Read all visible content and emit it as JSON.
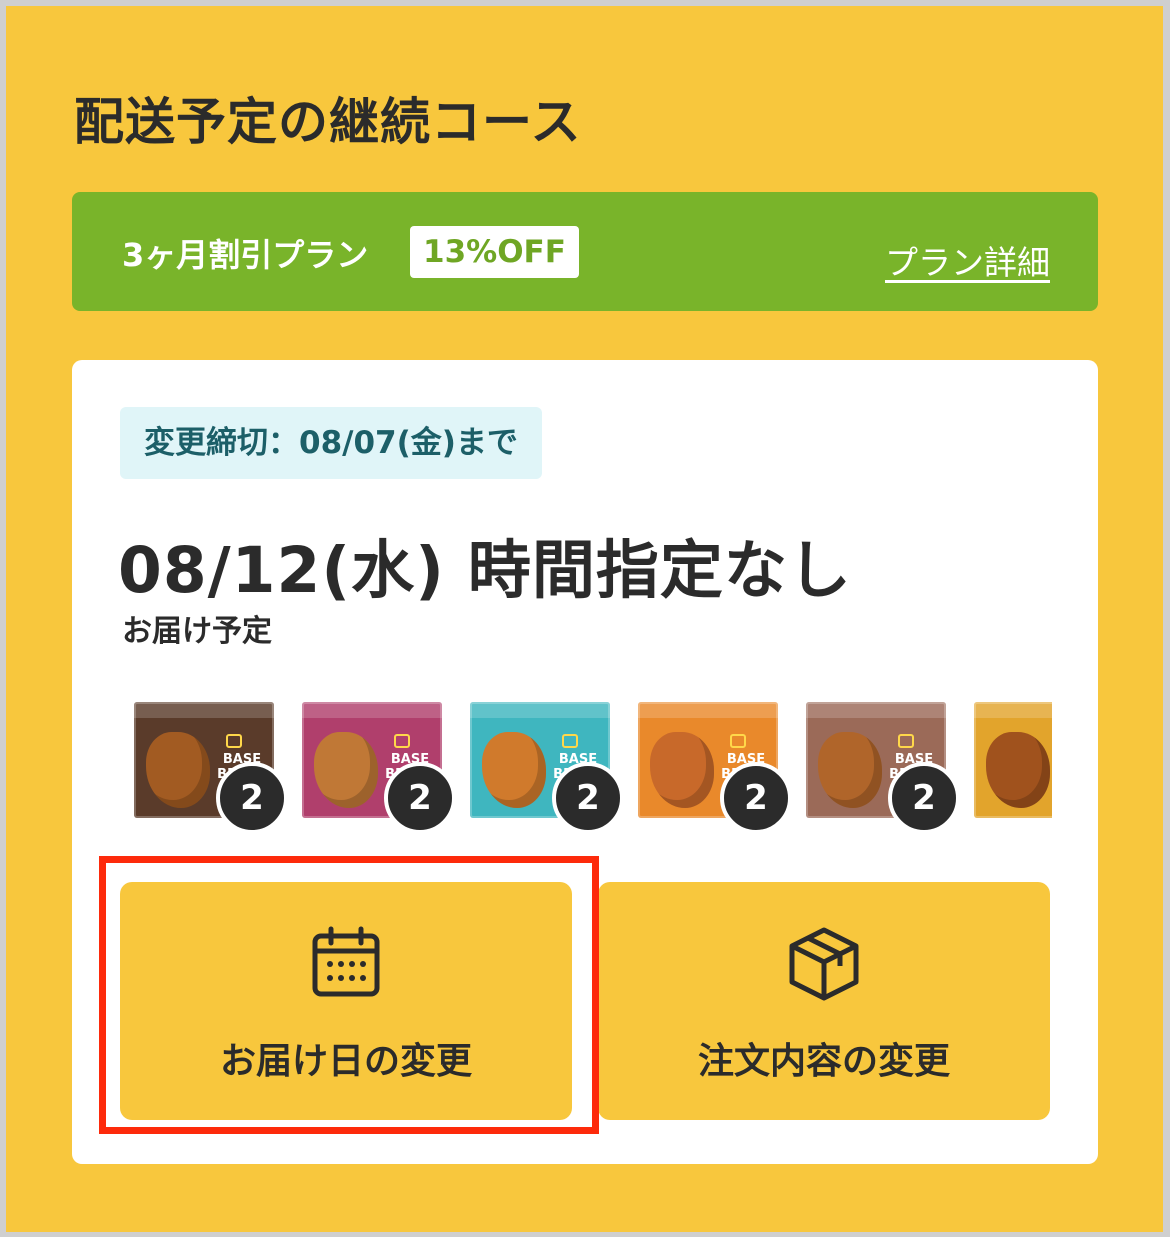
{
  "page": {
    "title": "配送予定の継続コース"
  },
  "plan": {
    "name": "3ヶ月割引プラン",
    "discount": "13%OFF",
    "detail_link": "プラン詳細"
  },
  "delivery": {
    "deadline": "変更締切：08/07(金)まで",
    "date": "08/12(水) 時間指定なし",
    "caption": "お届け予定"
  },
  "products": [
    {
      "brand": "BASE BREAD",
      "quantity": "2",
      "color": "#5a3b2a",
      "bread_color": "#a25b22"
    },
    {
      "brand": "BASE BREAD",
      "quantity": "2",
      "color": "#b03f6c",
      "bread_color": "#c07836"
    },
    {
      "brand": "BASE BREAD",
      "quantity": "2",
      "color": "#3fb6bf",
      "bread_color": "#d07a2c"
    },
    {
      "brand": "BASE BREAD",
      "quantity": "2",
      "color": "#e9892b",
      "bread_color": "#c8692a"
    },
    {
      "brand": "BASE BREAD",
      "quantity": "2",
      "color": "#9b6a58",
      "bread_color": "#b0652a"
    },
    {
      "brand": "",
      "quantity": "",
      "color": "#e2a42c",
      "bread_color": "#a0521d"
    }
  ],
  "actions": {
    "change_date": {
      "label": "お届け日の変更",
      "icon": "calendar-icon"
    },
    "change_order": {
      "label": "注文内容の変更",
      "icon": "package-box-icon"
    }
  },
  "colors": {
    "background": "#f8c73d",
    "plan_bar": "#79b42a",
    "deadline_badge": "#e0f5f8",
    "highlight": "#fd2a0b"
  }
}
